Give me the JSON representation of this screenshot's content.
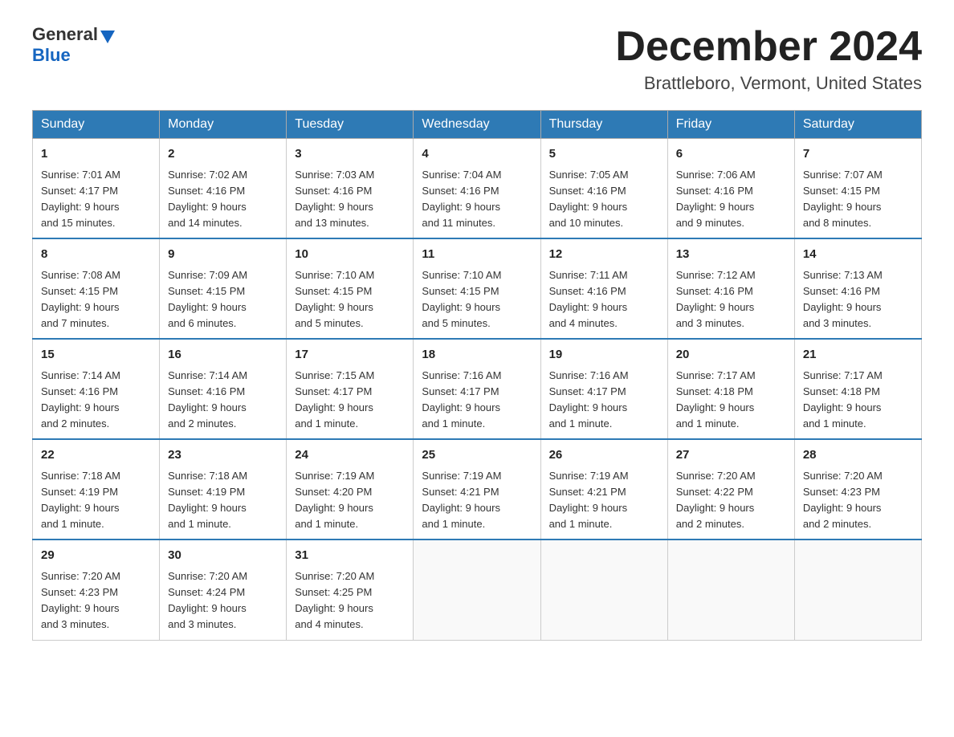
{
  "header": {
    "logo_general": "General",
    "logo_blue": "Blue",
    "month_title": "December 2024",
    "location": "Brattleboro, Vermont, United States"
  },
  "weekdays": [
    "Sunday",
    "Monday",
    "Tuesday",
    "Wednesday",
    "Thursday",
    "Friday",
    "Saturday"
  ],
  "weeks": [
    [
      {
        "day": "1",
        "sunrise": "7:01 AM",
        "sunset": "4:17 PM",
        "daylight": "9 hours and 15 minutes."
      },
      {
        "day": "2",
        "sunrise": "7:02 AM",
        "sunset": "4:16 PM",
        "daylight": "9 hours and 14 minutes."
      },
      {
        "day": "3",
        "sunrise": "7:03 AM",
        "sunset": "4:16 PM",
        "daylight": "9 hours and 13 minutes."
      },
      {
        "day": "4",
        "sunrise": "7:04 AM",
        "sunset": "4:16 PM",
        "daylight": "9 hours and 11 minutes."
      },
      {
        "day": "5",
        "sunrise": "7:05 AM",
        "sunset": "4:16 PM",
        "daylight": "9 hours and 10 minutes."
      },
      {
        "day": "6",
        "sunrise": "7:06 AM",
        "sunset": "4:16 PM",
        "daylight": "9 hours and 9 minutes."
      },
      {
        "day": "7",
        "sunrise": "7:07 AM",
        "sunset": "4:15 PM",
        "daylight": "9 hours and 8 minutes."
      }
    ],
    [
      {
        "day": "8",
        "sunrise": "7:08 AM",
        "sunset": "4:15 PM",
        "daylight": "9 hours and 7 minutes."
      },
      {
        "day": "9",
        "sunrise": "7:09 AM",
        "sunset": "4:15 PM",
        "daylight": "9 hours and 6 minutes."
      },
      {
        "day": "10",
        "sunrise": "7:10 AM",
        "sunset": "4:15 PM",
        "daylight": "9 hours and 5 minutes."
      },
      {
        "day": "11",
        "sunrise": "7:10 AM",
        "sunset": "4:15 PM",
        "daylight": "9 hours and 5 minutes."
      },
      {
        "day": "12",
        "sunrise": "7:11 AM",
        "sunset": "4:16 PM",
        "daylight": "9 hours and 4 minutes."
      },
      {
        "day": "13",
        "sunrise": "7:12 AM",
        "sunset": "4:16 PM",
        "daylight": "9 hours and 3 minutes."
      },
      {
        "day": "14",
        "sunrise": "7:13 AM",
        "sunset": "4:16 PM",
        "daylight": "9 hours and 3 minutes."
      }
    ],
    [
      {
        "day": "15",
        "sunrise": "7:14 AM",
        "sunset": "4:16 PM",
        "daylight": "9 hours and 2 minutes."
      },
      {
        "day": "16",
        "sunrise": "7:14 AM",
        "sunset": "4:16 PM",
        "daylight": "9 hours and 2 minutes."
      },
      {
        "day": "17",
        "sunrise": "7:15 AM",
        "sunset": "4:17 PM",
        "daylight": "9 hours and 1 minute."
      },
      {
        "day": "18",
        "sunrise": "7:16 AM",
        "sunset": "4:17 PM",
        "daylight": "9 hours and 1 minute."
      },
      {
        "day": "19",
        "sunrise": "7:16 AM",
        "sunset": "4:17 PM",
        "daylight": "9 hours and 1 minute."
      },
      {
        "day": "20",
        "sunrise": "7:17 AM",
        "sunset": "4:18 PM",
        "daylight": "9 hours and 1 minute."
      },
      {
        "day": "21",
        "sunrise": "7:17 AM",
        "sunset": "4:18 PM",
        "daylight": "9 hours and 1 minute."
      }
    ],
    [
      {
        "day": "22",
        "sunrise": "7:18 AM",
        "sunset": "4:19 PM",
        "daylight": "9 hours and 1 minute."
      },
      {
        "day": "23",
        "sunrise": "7:18 AM",
        "sunset": "4:19 PM",
        "daylight": "9 hours and 1 minute."
      },
      {
        "day": "24",
        "sunrise": "7:19 AM",
        "sunset": "4:20 PM",
        "daylight": "9 hours and 1 minute."
      },
      {
        "day": "25",
        "sunrise": "7:19 AM",
        "sunset": "4:21 PM",
        "daylight": "9 hours and 1 minute."
      },
      {
        "day": "26",
        "sunrise": "7:19 AM",
        "sunset": "4:21 PM",
        "daylight": "9 hours and 1 minute."
      },
      {
        "day": "27",
        "sunrise": "7:20 AM",
        "sunset": "4:22 PM",
        "daylight": "9 hours and 2 minutes."
      },
      {
        "day": "28",
        "sunrise": "7:20 AM",
        "sunset": "4:23 PM",
        "daylight": "9 hours and 2 minutes."
      }
    ],
    [
      {
        "day": "29",
        "sunrise": "7:20 AM",
        "sunset": "4:23 PM",
        "daylight": "9 hours and 3 minutes."
      },
      {
        "day": "30",
        "sunrise": "7:20 AM",
        "sunset": "4:24 PM",
        "daylight": "9 hours and 3 minutes."
      },
      {
        "day": "31",
        "sunrise": "7:20 AM",
        "sunset": "4:25 PM",
        "daylight": "9 hours and 4 minutes."
      },
      null,
      null,
      null,
      null
    ]
  ],
  "labels": {
    "sunrise": "Sunrise:",
    "sunset": "Sunset:",
    "daylight": "Daylight:"
  }
}
